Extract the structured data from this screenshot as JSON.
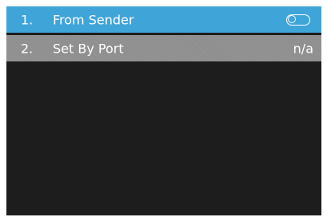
{
  "menu": {
    "items": [
      {
        "number": "1.",
        "label": "From Sender",
        "control": "toggle",
        "toggle_state": "off",
        "selected": true
      },
      {
        "number": "2.",
        "label": "Set By Port",
        "value": "n/a",
        "selected": false
      }
    ]
  },
  "colors": {
    "selected_row": "#3fa5d9",
    "unselected_row": "#8e8e8e",
    "screen_background": "#1d1d1d",
    "text": "#ffffff"
  }
}
